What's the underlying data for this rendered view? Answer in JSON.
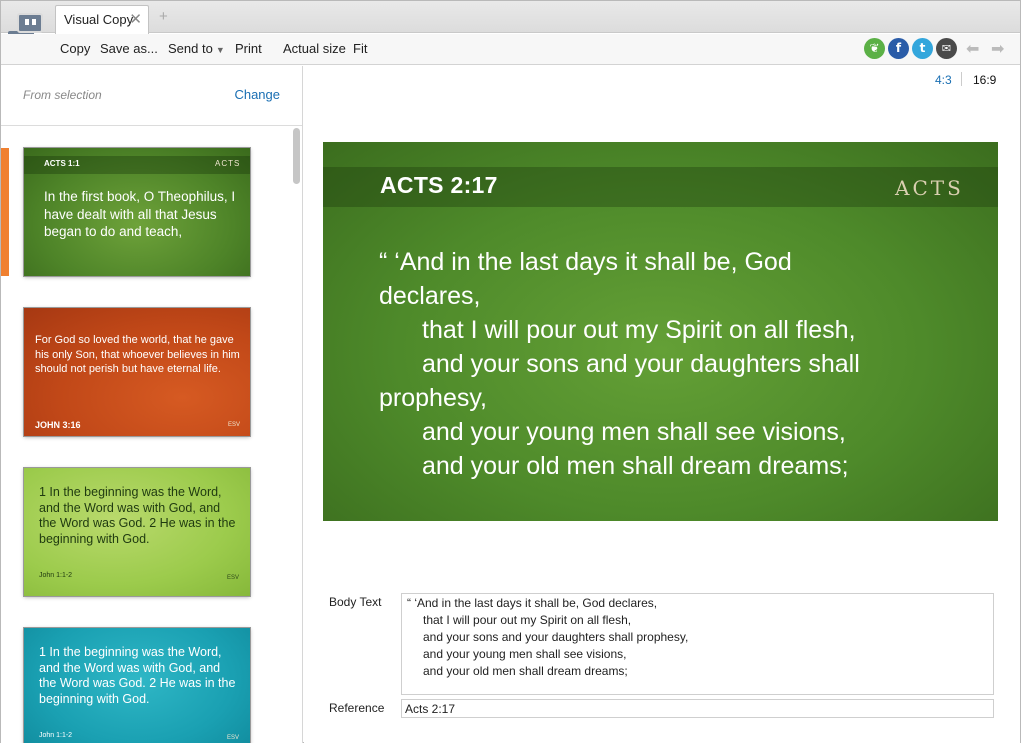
{
  "tab": {
    "label": "Visual Copy",
    "close": "✕",
    "add": "+"
  },
  "toolbar": {
    "copy": "Copy",
    "save_as": "Save as...",
    "send_to": "Send to",
    "print": "Print",
    "actual_size": "Actual size",
    "fit": "Fit"
  },
  "share": {
    "faithlife": "❦",
    "facebook": "f",
    "twitter": "t",
    "email": "✉",
    "colors": {
      "faithlife": "#5bb046",
      "facebook": "#2a5ca8",
      "twitter": "#33a6dc",
      "email": "#4a4a4a"
    }
  },
  "left_panel": {
    "from_selection": "From selection",
    "change": "Change",
    "thumbnails": [
      {
        "ref": "ACTS 1:1",
        "version": "ACTS",
        "text": "In the first book, O Theophilus, I have dealt with all that Jesus began to do and teach,"
      },
      {
        "ref": "JOHN 3:16",
        "version": "ESV",
        "text": "For God so loved the world, that he gave his only Son, that whoever believes in him should not perish but have eternal life."
      },
      {
        "ref": "John 1:1-2",
        "version": "ESV",
        "text": "1 In the beginning was the Word, and the Word was with God, and the Word was God. 2 He was in the beginning with God."
      },
      {
        "ref": "John 1:1-2",
        "version": "ESV",
        "text": "1 In the beginning was the Word, and the Word was with God, and the Word was God. 2 He was in the beginning with God."
      }
    ]
  },
  "aspect": {
    "ratio_43": "4:3",
    "ratio_169": "16:9"
  },
  "preview": {
    "ref": "ACTS 2:17",
    "book": "ACTS",
    "lines": [
      "“ ‘And in the last days it shall be, God",
      "declares,",
      "that I will pour out my Spirit on all flesh,",
      "and your sons and your daughters shall",
      "prophesy,",
      "and your young men shall see visions,",
      "and your old men shall dream dreams;"
    ]
  },
  "fields": {
    "body_label": "Body Text",
    "body_lines": [
      "“ ‘And in the last days it shall be, God declares,",
      "that I will pour out my Spirit on all flesh,",
      "and your sons and your daughters shall prophesy,",
      "and your young men shall see visions,",
      "and your old men shall dream dreams;"
    ],
    "reference_label": "Reference",
    "reference_value": "Acts 2:17"
  }
}
